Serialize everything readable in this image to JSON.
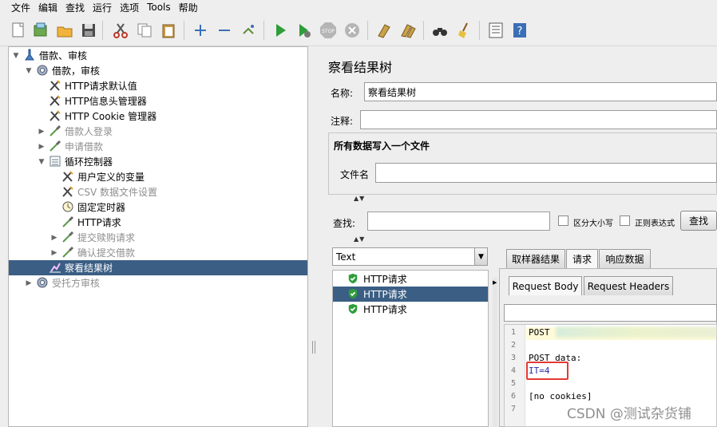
{
  "menu": [
    "文件",
    "编辑",
    "查找",
    "运行",
    "选项",
    "Tools",
    "帮助"
  ],
  "toolbar": {
    "icons": [
      "new-icon",
      "templates-icon",
      "open-icon",
      "save-icon",
      "cut-icon",
      "copy-icon",
      "paste-icon",
      "expand-icon",
      "collapse-icon",
      "toggle-icon",
      "start-icon",
      "start-no-pause-icon",
      "stop-icon",
      "shutdown-icon",
      "clear-icon",
      "clear-all-icon",
      "search-binoculars-icon",
      "reset-search-broom-icon",
      "function-helper-icon",
      "help-icon"
    ],
    "stop_label": "STOP"
  },
  "tree": [
    {
      "label": "借款、审核",
      "icon": "test-plan-icon",
      "toggle": "▼",
      "level": 0,
      "disabled": false
    },
    {
      "label": "借款，审核",
      "icon": "thread-group-icon",
      "toggle": "▼",
      "level": 1,
      "disabled": false
    },
    {
      "label": "HTTP请求默认值",
      "icon": "config-wrench-icon",
      "toggle": "",
      "level": 2,
      "disabled": false
    },
    {
      "label": "HTTP信息头管理器",
      "icon": "config-wrench-icon",
      "toggle": "",
      "level": 2,
      "disabled": false
    },
    {
      "label": "HTTP Cookie 管理器",
      "icon": "config-wrench-icon",
      "toggle": "",
      "level": 2,
      "disabled": false
    },
    {
      "label": "借款人登录",
      "icon": "sampler-pipette-icon",
      "toggle": "▶",
      "level": 2,
      "disabled": true
    },
    {
      "label": "申请借款",
      "icon": "sampler-pipette-icon",
      "toggle": "▶",
      "level": 2,
      "disabled": true
    },
    {
      "label": "循环控制器",
      "icon": "loop-controller-icon",
      "toggle": "▼",
      "level": 2,
      "disabled": false
    },
    {
      "label": "用户定义的变量",
      "icon": "config-wrench-icon",
      "toggle": "",
      "level": 3,
      "disabled": false
    },
    {
      "label": "CSV 数据文件设置",
      "icon": "config-wrench-icon",
      "toggle": "",
      "level": 3,
      "disabled": true
    },
    {
      "label": "固定定时器",
      "icon": "timer-clock-icon",
      "toggle": "",
      "level": 3,
      "disabled": false
    },
    {
      "label": "HTTP请求",
      "icon": "sampler-pipette-icon",
      "toggle": "",
      "level": 3,
      "disabled": false
    },
    {
      "label": "提交赎购请求",
      "icon": "sampler-pipette-icon",
      "toggle": "▶",
      "level": 3,
      "disabled": true
    },
    {
      "label": "确认提交借款",
      "icon": "sampler-pipette-icon",
      "toggle": "▶",
      "level": 3,
      "disabled": true
    },
    {
      "label": "察看结果树",
      "icon": "listener-chart-icon",
      "toggle": "",
      "level": 2,
      "disabled": false,
      "selected": true
    },
    {
      "label": "受托方审核",
      "icon": "thread-group-icon",
      "toggle": "▶",
      "level": 1,
      "disabled": true
    }
  ],
  "panel": {
    "title": "察看结果树",
    "name_label": "名称:",
    "name_value": "察看结果树",
    "comment_label": "注释:",
    "comment_value": "",
    "file_group_title": "所有数据写入一个文件",
    "filename_label": "文件名",
    "filename_value": "",
    "dots": "▲▼",
    "search_label": "查找:",
    "search_value": "",
    "case_label": "区分大小写",
    "regex_label": "正则表达式",
    "search_button": "查找",
    "renderer_value": "Text"
  },
  "results": [
    {
      "label": "HTTP请求",
      "icon": "success-shield-icon",
      "selected": false
    },
    {
      "label": "HTTP请求",
      "icon": "success-shield-icon",
      "selected": true
    },
    {
      "label": "HTTP请求",
      "icon": "success-shield-icon",
      "selected": false
    }
  ],
  "tabs": [
    "取样器结果",
    "请求",
    "响应数据"
  ],
  "subtabs": [
    "Request Body",
    "Request Headers"
  ],
  "code": {
    "lines": [
      "POST ",
      "",
      "POST data:",
      "IT=4",
      "",
      "[no cookies]",
      ""
    ],
    "line_numbers": [
      "1",
      "2",
      "3",
      "4",
      "5",
      "6",
      "7"
    ]
  },
  "watermark": "CSDN @测试杂货铺"
}
